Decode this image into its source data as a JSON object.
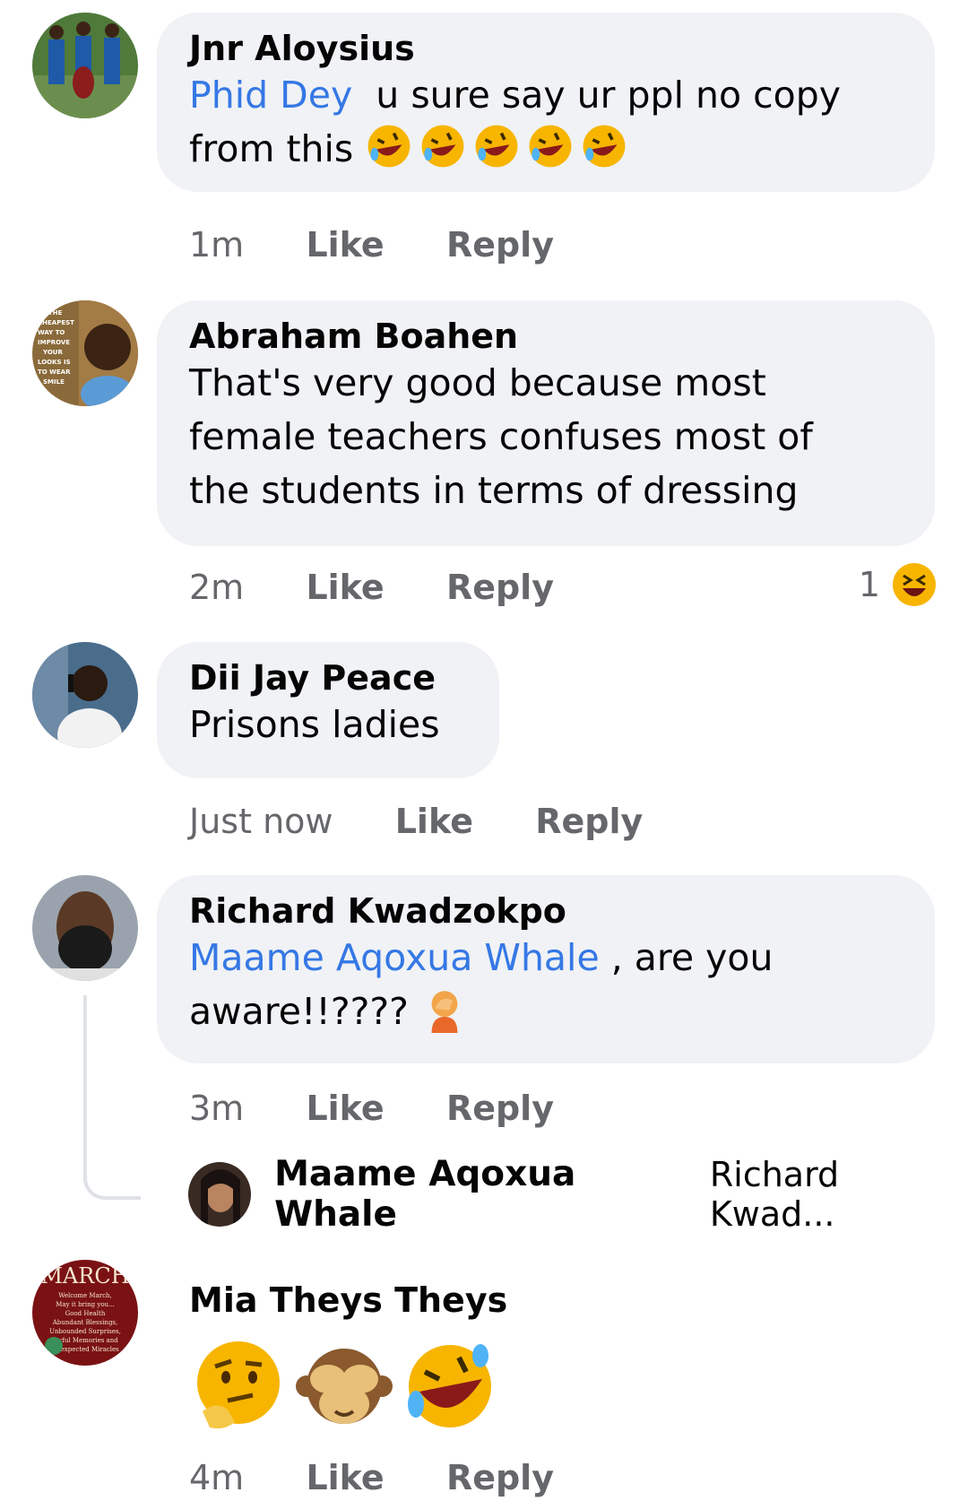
{
  "comments": [
    {
      "author": "Jnr Aloysius",
      "mention": "Phid Dey",
      "text_line1": "u sure say ur ppl no copy",
      "text_line2": "from this",
      "time": "1m",
      "like": "Like",
      "reply": "Reply"
    },
    {
      "author": "Abraham Boahen",
      "line1": "That's very good because most",
      "line2": "female teachers confuses most of",
      "line3": "the students in terms of dressing",
      "time": "2m",
      "like": "Like",
      "reply": "Reply",
      "reaction_count": "1"
    },
    {
      "author": "Dii Jay Peace",
      "text": "Prisons ladies",
      "time": "Just now",
      "like": "Like",
      "reply": "Reply"
    },
    {
      "author": "Richard Kwadzokpo",
      "mention": "Maame Aqoxua Whale",
      "text_line1": ", are you",
      "text_line2": "aware!!????",
      "time": "3m",
      "like": "Like",
      "reply": "Reply",
      "reply_author": "Maame Aqoxua Whale",
      "reply_preview": "Richard Kwad..."
    },
    {
      "author": "Mia Theys Theys",
      "time": "4m",
      "like": "Like",
      "reply": "Reply"
    }
  ],
  "avatar_text": {
    "abraham": [
      "THE",
      "CHEAPEST",
      "WAY TO",
      "IMPROVE",
      "YOUR",
      "LOOKS IS",
      "TO WEAR",
      "SMILE"
    ],
    "mia_title": "MARCH",
    "mia_lines": [
      "Welcome March,",
      "May it bring you...",
      "Good Health",
      "Abundant Blessings,",
      "Unbounded Surprises,",
      "Joyful Memories and",
      "Unexpected Miracles"
    ]
  },
  "colors": {
    "bubble": "#f0f2f5",
    "mention": "#3578e5",
    "meta": "#65676b"
  }
}
